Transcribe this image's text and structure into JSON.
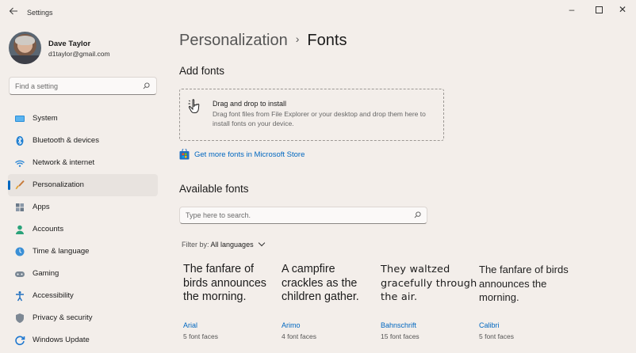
{
  "window": {
    "title": "Settings",
    "controls": {
      "minimize": "–",
      "maximize": "",
      "close": "✕"
    }
  },
  "user": {
    "name": "Dave Taylor",
    "email": "d1taylor@gmail.com"
  },
  "sidebar": {
    "search_placeholder": "Find a setting",
    "items": [
      {
        "label": "System",
        "icon": "monitor-icon"
      },
      {
        "label": "Bluetooth & devices",
        "icon": "bluetooth-icon"
      },
      {
        "label": "Network & internet",
        "icon": "wifi-icon"
      },
      {
        "label": "Personalization",
        "icon": "paintbrush-icon",
        "active": true
      },
      {
        "label": "Apps",
        "icon": "apps-icon"
      },
      {
        "label": "Accounts",
        "icon": "person-icon"
      },
      {
        "label": "Time & language",
        "icon": "globe-clock-icon"
      },
      {
        "label": "Gaming",
        "icon": "gamepad-icon"
      },
      {
        "label": "Accessibility",
        "icon": "accessibility-icon"
      },
      {
        "label": "Privacy & security",
        "icon": "shield-icon"
      },
      {
        "label": "Windows Update",
        "icon": "update-icon"
      }
    ]
  },
  "breadcrumb": {
    "parent": "Personalization",
    "separator": "›",
    "current": "Fonts"
  },
  "add_fonts": {
    "heading": "Add fonts",
    "drop_title": "Drag and drop to install",
    "drop_description": "Drag font files from File Explorer or your desktop and drop them here to install fonts on your device.",
    "store_link": "Get more fonts in Microsoft Store"
  },
  "available_fonts": {
    "heading": "Available fonts",
    "search_placeholder": "Type here to search.",
    "filter_label": "Filter by:",
    "filter_value": "All languages",
    "fonts": [
      {
        "sample": "The fanfare of birds announces the morning.",
        "name": "Arial",
        "faces": "5 font faces"
      },
      {
        "sample": "A campfire crackles as the children gather.",
        "name": "Arimo",
        "faces": "4 font faces"
      },
      {
        "sample": "They waltzed gracefully through the air.",
        "name": "Bahnschrift",
        "faces": "15 font faces"
      },
      {
        "sample": "The fanfare of birds announces the morning.",
        "name": "Calibri",
        "faces": "5 font faces"
      }
    ]
  },
  "colors": {
    "accent": "#0067c0",
    "background": "#f3eeea",
    "active_nav": "#e8e3df"
  }
}
